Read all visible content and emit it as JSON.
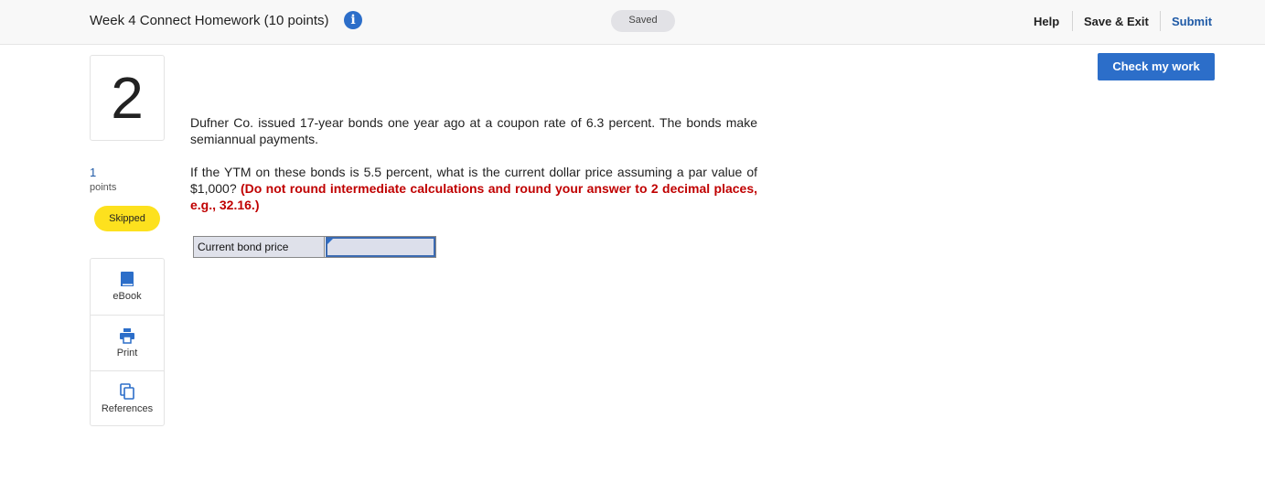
{
  "header": {
    "title": "Week 4 Connect Homework (10 points)",
    "info_icon": "info-icon",
    "saved_status": "Saved",
    "help_label": "Help",
    "save_exit_label": "Save & Exit",
    "submit_label": "Submit"
  },
  "check_my_work_label": "Check my work",
  "sidebar": {
    "question_number": "2",
    "points_value": "1",
    "points_label": "points",
    "status_badge": "Skipped",
    "tools": [
      {
        "label": "eBook",
        "icon": "book-icon"
      },
      {
        "label": "Print",
        "icon": "printer-icon"
      },
      {
        "label": "References",
        "icon": "copy-icon"
      }
    ]
  },
  "question": {
    "paragraph1": "Dufner Co. issued 17-year bonds one year ago at a coupon rate of 6.3 percent. The bonds make semiannual payments.",
    "paragraph2_text": "If the YTM on these bonds is 5.5 percent, what is the current dollar price assuming a par value of $1,000?",
    "paragraph2_instruction": "(Do not round intermediate calculations and round your answer to 2 decimal places, e.g., 32.16.)"
  },
  "answer": {
    "label": "Current bond price",
    "value": ""
  },
  "colors": {
    "accent": "#2c6ec9",
    "skipped_badge": "#fde11e",
    "instruction_red": "#c00000"
  }
}
